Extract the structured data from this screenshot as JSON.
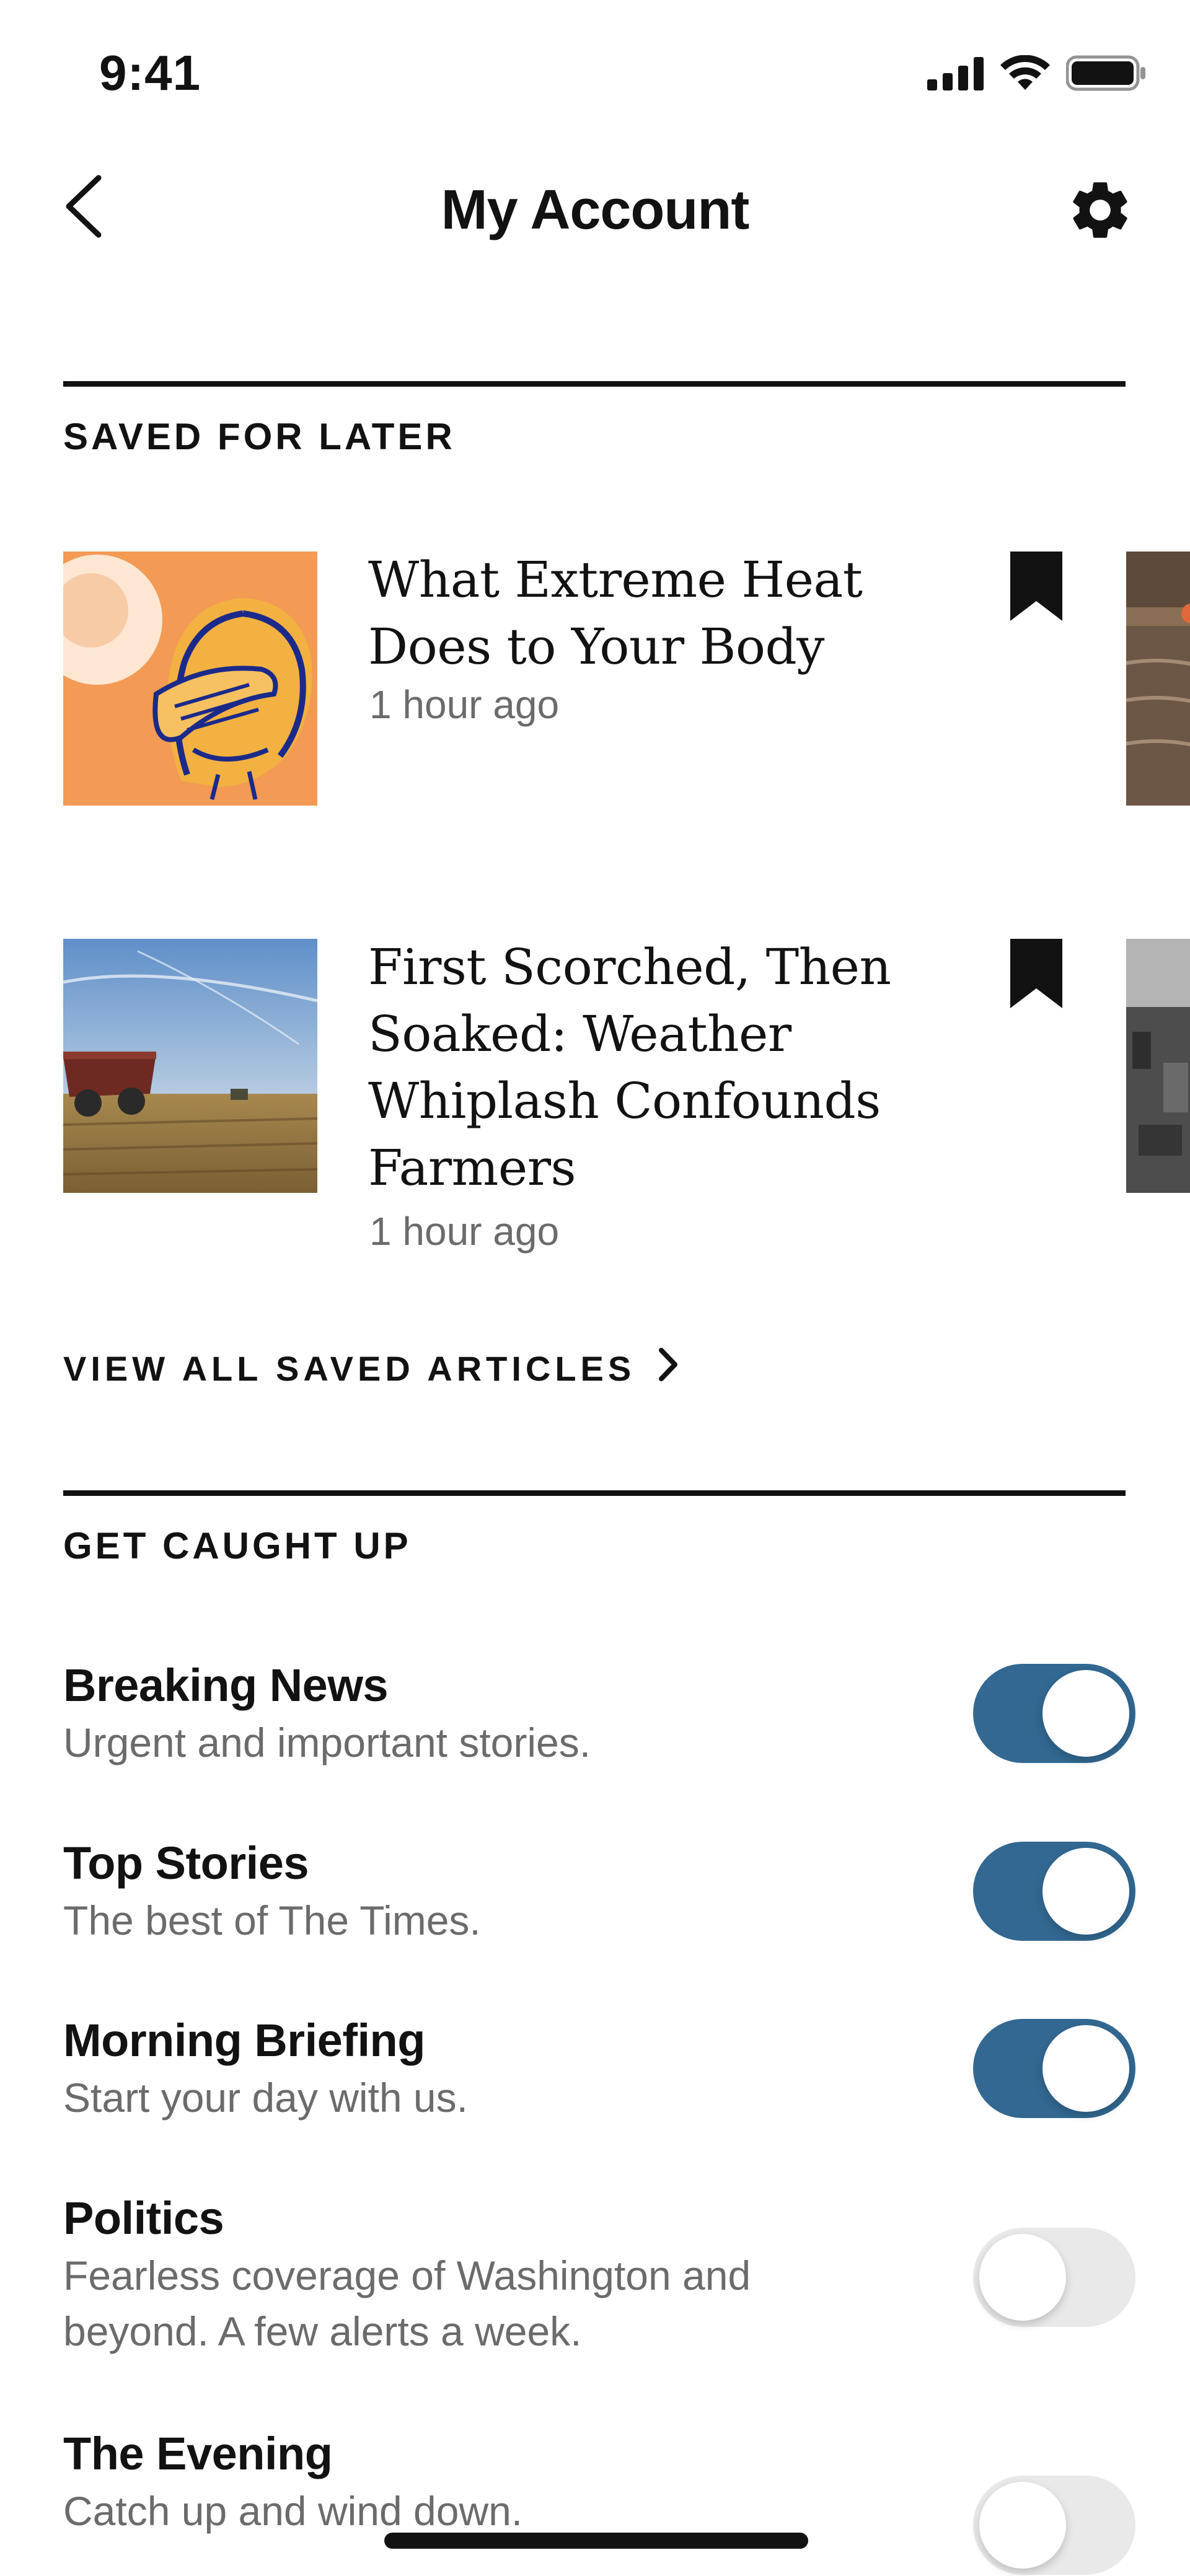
{
  "status_bar": {
    "time": "9:41"
  },
  "header": {
    "title": "My Account",
    "back_icon": "chevron-left-icon",
    "settings_icon": "gear-icon"
  },
  "saved_section": {
    "label": "SAVED FOR LATER",
    "articles": [
      {
        "title": "What Extreme Heat Does to Your Body",
        "time": "1 hour ago",
        "bookmark_icon": "bookmark-icon"
      },
      {
        "title": "First Scorched, Then Soaked: Weather Whiplash Confounds Farmers",
        "time": "1 hour ago",
        "bookmark_icon": "bookmark-icon"
      }
    ],
    "view_all_label": "VIEW ALL SAVED ARTICLES"
  },
  "caught_up_section": {
    "label": "GET CAUGHT UP",
    "items": [
      {
        "title": "Breaking News",
        "description": "Urgent and important stories.",
        "enabled": true
      },
      {
        "title": "Top Stories",
        "description": "The best of The Times.",
        "enabled": true
      },
      {
        "title": "Morning Briefing",
        "description": "Start your day with us.",
        "enabled": true
      },
      {
        "title": "Politics",
        "description": "Fearless coverage of Washington and beyond. A few alerts a week.",
        "enabled": false
      },
      {
        "title": "The Evening",
        "description": "Catch up and wind down.",
        "enabled": false
      }
    ]
  },
  "colors": {
    "toggle_on": "#326891",
    "toggle_off": "#e9e9ea",
    "text": "#121212",
    "muted": "#6b6b6b"
  }
}
